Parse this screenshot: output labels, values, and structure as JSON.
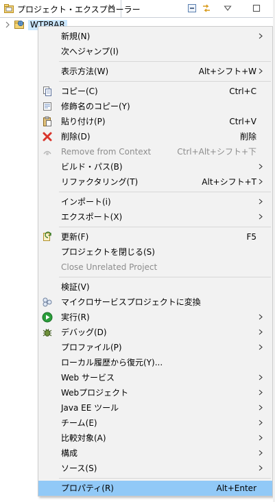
{
  "view": {
    "tab_title": "プロジェクト・エクスプローラー",
    "tab_icon": "package-explorer-icon",
    "toolbar_icons": [
      "collapse-all-icon",
      "link-with-editor-icon",
      "view-menu-icon",
      "minimize-icon"
    ]
  },
  "tree": {
    "project_label": "WTPRAR",
    "project_icon": "web-project-icon"
  },
  "menu": {
    "items": [
      {
        "label": "新規(N)",
        "submenu": true
      },
      {
        "label": "次へジャンプ(I)"
      },
      {
        "label": "表示方法(W)",
        "accel": "Alt+シフト+W",
        "submenu": true
      },
      {
        "label": "コピー(C)",
        "accel": "Ctrl+C",
        "icon": "copy-icon"
      },
      {
        "label": "修飾名のコピー(Y)",
        "icon": "copy-qualified-name-icon"
      },
      {
        "label": "貼り付け(P)",
        "accel": "Ctrl+V",
        "icon": "paste-icon"
      },
      {
        "label": "削除(D)",
        "accel": "削除",
        "icon": "delete-icon"
      },
      {
        "label": "Remove from Context",
        "accel": "Ctrl+Alt+シフト+下",
        "icon": "remove-context-icon",
        "disabled": true
      },
      {
        "label": "ビルド・パス(B)",
        "submenu": true
      },
      {
        "label": "リファクタリング(T)",
        "accel": "Alt+シフト+T",
        "submenu": true
      },
      {
        "label": "インポート(i)",
        "submenu": true
      },
      {
        "label": "エクスポート(X)",
        "submenu": true
      },
      {
        "label": "更新(F)",
        "accel": "F5",
        "icon": "refresh-icon"
      },
      {
        "label": "プロジェクトを閉じる(S)"
      },
      {
        "label": "Close Unrelated Project",
        "disabled": true
      },
      {
        "label": "検証(V)"
      },
      {
        "label": "マイクロサービスプロジェクトに変換",
        "icon": "microservice-icon"
      },
      {
        "label": "実行(R)",
        "icon": "run-icon",
        "submenu": true
      },
      {
        "label": "デバッグ(D)",
        "icon": "debug-icon",
        "submenu": true
      },
      {
        "label": "プロファイル(P)",
        "submenu": true
      },
      {
        "label": "ローカル履歴から復元(Y)..."
      },
      {
        "label": "Web サービス",
        "submenu": true
      },
      {
        "label": "Webプロジェクト",
        "submenu": true
      },
      {
        "label": "Java EE ツール",
        "submenu": true
      },
      {
        "label": "チーム(E)",
        "submenu": true
      },
      {
        "label": "比較対象(A)",
        "submenu": true
      },
      {
        "label": "構成",
        "submenu": true
      },
      {
        "label": "ソース(S)",
        "submenu": true
      },
      {
        "label": "プロパティ(R)",
        "accel": "Alt+Enter",
        "selected": true
      }
    ]
  },
  "colors": {
    "selection": "#91c9f7",
    "tree_selection": "#cce8ff",
    "menu_bg": "#f2f2f2",
    "disabled_text": "#8d8d8d",
    "delete_red": "#d9342b",
    "run_green": "#2a9d3a"
  }
}
